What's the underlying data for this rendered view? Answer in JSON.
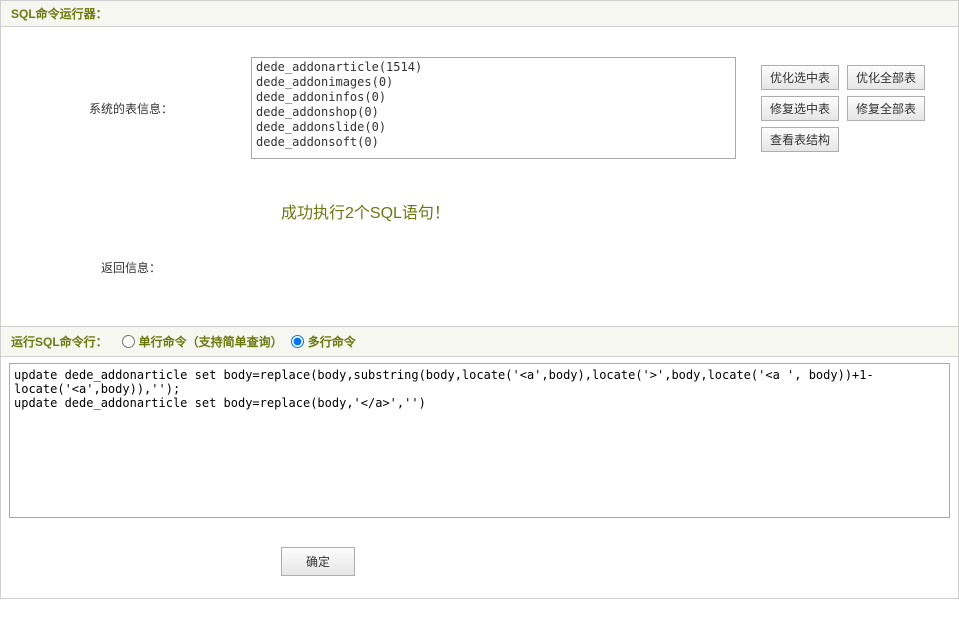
{
  "header": {
    "title": "SQL命令运行器："
  },
  "tableInfo": {
    "label": "系统的表信息：",
    "items": [
      "dede_addonarticle(1514)",
      "dede_addonimages(0)",
      "dede_addoninfos(0)",
      "dede_addonshop(0)",
      "dede_addonslide(0)",
      "dede_addonsoft(0)"
    ]
  },
  "buttons": {
    "optimizeSelected": "优化选中表",
    "optimizeAll": "优化全部表",
    "repairSelected": "修复选中表",
    "repairAll": "修复全部表",
    "viewStructure": "查看表结构"
  },
  "returnInfo": {
    "label": "返回信息：",
    "message": "成功执行2个SQL语句！"
  },
  "sqlCmd": {
    "title": "运行SQL命令行：",
    "singleLabel": "单行命令（支持简单查询）",
    "multiLabel": "多行命令",
    "mode": "multi",
    "content": "update dede_addonarticle set body=replace(body,substring(body,locate('<a',body),locate('>',body,locate('<a ', body))+1-locate('<a',body)),'');\nupdate dede_addonarticle set body=replace(body,'</a>','')"
  },
  "submit": {
    "label": "确定"
  }
}
